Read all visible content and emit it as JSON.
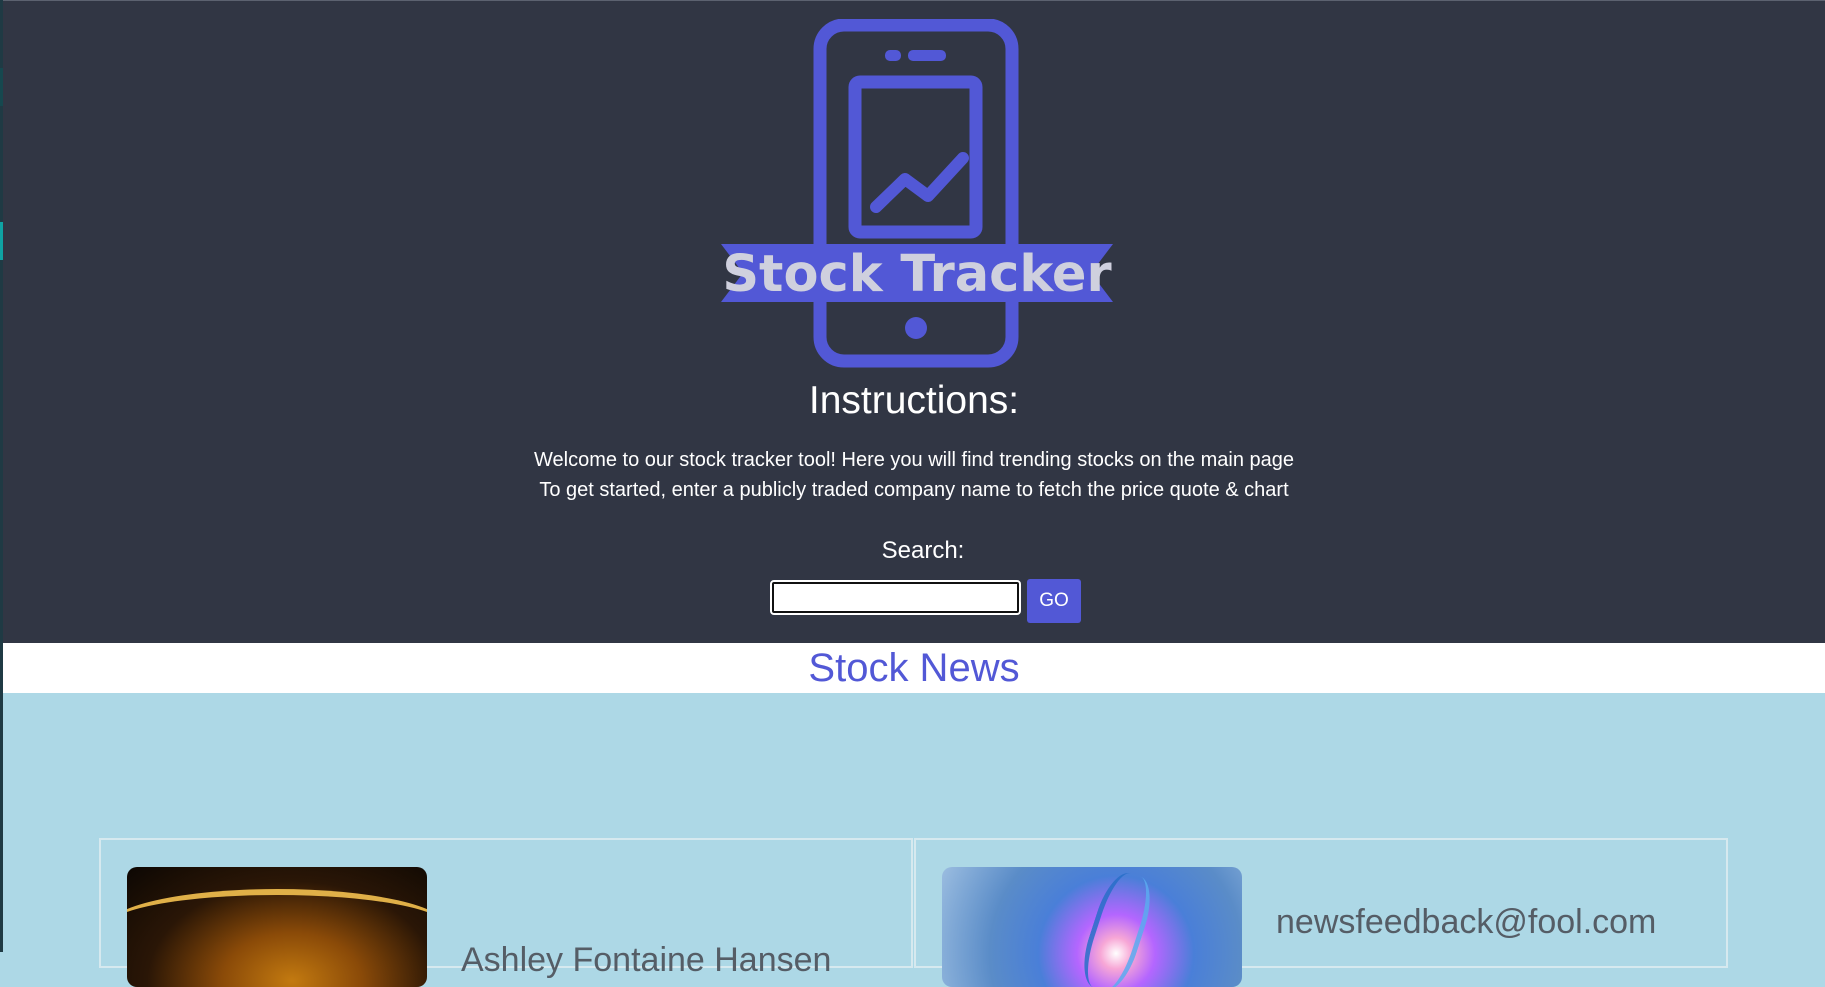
{
  "brand": {
    "logo_text": "Stock Tracker",
    "accent_color": "#5258d6",
    "header_bg": "#313644",
    "news_bg": "#add8e6"
  },
  "instructions": {
    "title": "Instructions:",
    "line1": "Welcome to our stock tracker tool! Here you will find trending stocks on the main page",
    "line2": "To get started, enter a publicly traded company name to fetch the price quote & chart"
  },
  "search": {
    "label": "Search:",
    "value": "",
    "placeholder": "",
    "button_label": "GO"
  },
  "news": {
    "title": "Stock News",
    "cards": [
      {
        "image": "gold-coin-photo",
        "text": "Ashley Fontaine Hansen"
      },
      {
        "image": "dna-helix-photo",
        "text": "newsfeedback@fool.com"
      }
    ]
  }
}
